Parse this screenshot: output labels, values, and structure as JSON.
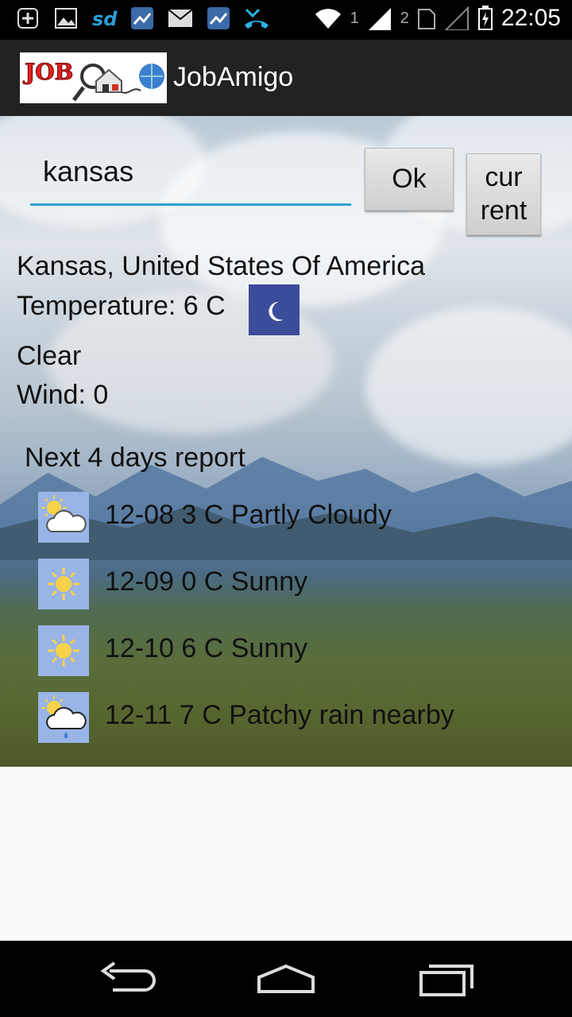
{
  "status_bar": {
    "time": "22:05",
    "sim1": "1",
    "sim2": "2",
    "icons": [
      "add-icon",
      "image-icon",
      "sd-icon",
      "chart-icon",
      "mail-icon",
      "chart-icon",
      "missed-call-icon",
      "wifi-icon",
      "signal-icon",
      "signal-icon",
      "battery-icon"
    ]
  },
  "app": {
    "title": "JobAmigo",
    "logo_text": "JOB"
  },
  "search": {
    "value": "kansas",
    "ok_label": "Ok",
    "current_label_line1": "cur",
    "current_label_line2": "rent"
  },
  "weather": {
    "location": "Kansas, United States Of America",
    "temperature": "Temperature: 6 C",
    "condition": "Clear",
    "wind": "Wind: 0",
    "icon": "moon-icon"
  },
  "forecast": {
    "heading": "Next 4 days report",
    "days": [
      {
        "text": "12-08  3 C  Partly Cloudy",
        "icon": "partly-cloudy-icon"
      },
      {
        "text": "12-09  0 C  Sunny",
        "icon": "sunny-icon"
      },
      {
        "text": "12-10  6 C  Sunny",
        "icon": "sunny-icon"
      },
      {
        "text": "12-11   7 C  Patchy rain nearby",
        "icon": "patchy-rain-icon"
      }
    ]
  },
  "colors": {
    "accent": "#2a9fd6",
    "actionbar": "#222222",
    "moon_box": "#3a4c9a",
    "forecast_icon_bg": "#99b4e6"
  }
}
